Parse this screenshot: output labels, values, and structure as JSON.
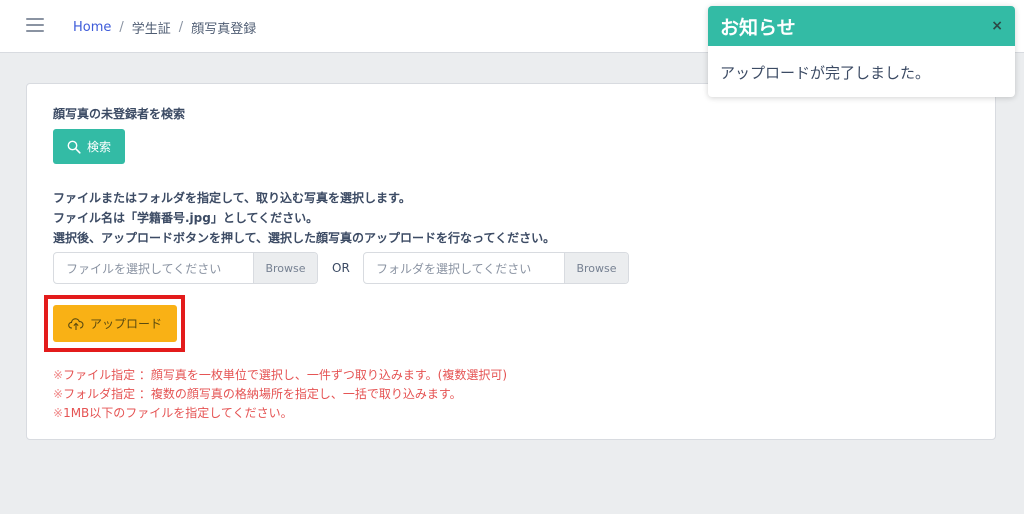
{
  "topbar": {
    "menu_icon": "hamburger-icon",
    "breadcrumb": {
      "home": "Home",
      "sep1": "/",
      "item1": "学生証",
      "sep2": "/",
      "item2": "顔写真登録"
    }
  },
  "toast": {
    "title": "お知らせ",
    "close": "×",
    "message": "アップロードが完了しました。",
    "color": "#33bba5"
  },
  "search": {
    "heading": "顔写真の未登録者を検索",
    "button_label": "検索",
    "icon": "search-icon",
    "color": "#33bba5"
  },
  "instructions": [
    "ファイルまたはフォルダを指定して、取り込む写真を選択します。",
    "ファイル名は「学籍番号.jpg」としてください。",
    "選択後、アップロードボタンを押して、選択した顔写真のアップロードを行なってください。"
  ],
  "file_input": {
    "placeholder": "ファイルを選択してください",
    "browse": "Browse"
  },
  "or_label": "OR",
  "folder_input": {
    "placeholder": "フォルダを選択してください",
    "browse": "Browse"
  },
  "upload": {
    "button_label": "アップロード",
    "icon": "cloud-upload-icon",
    "color": "#f9b115",
    "highlight_color": "#e31b1b"
  },
  "notes": [
    {
      "mark": "※",
      "text": "ファイル指定 ：顔写真を一枚単位で選択し、一件ずつ取り込みます。(複数選択可)"
    },
    {
      "mark": "※",
      "text": "フォルダ指定 ：複数の顔写真の格納場所を指定し、一括で取り込みます。"
    },
    {
      "mark": "※",
      "text": "1MB以下のファイルを指定してください。"
    }
  ]
}
